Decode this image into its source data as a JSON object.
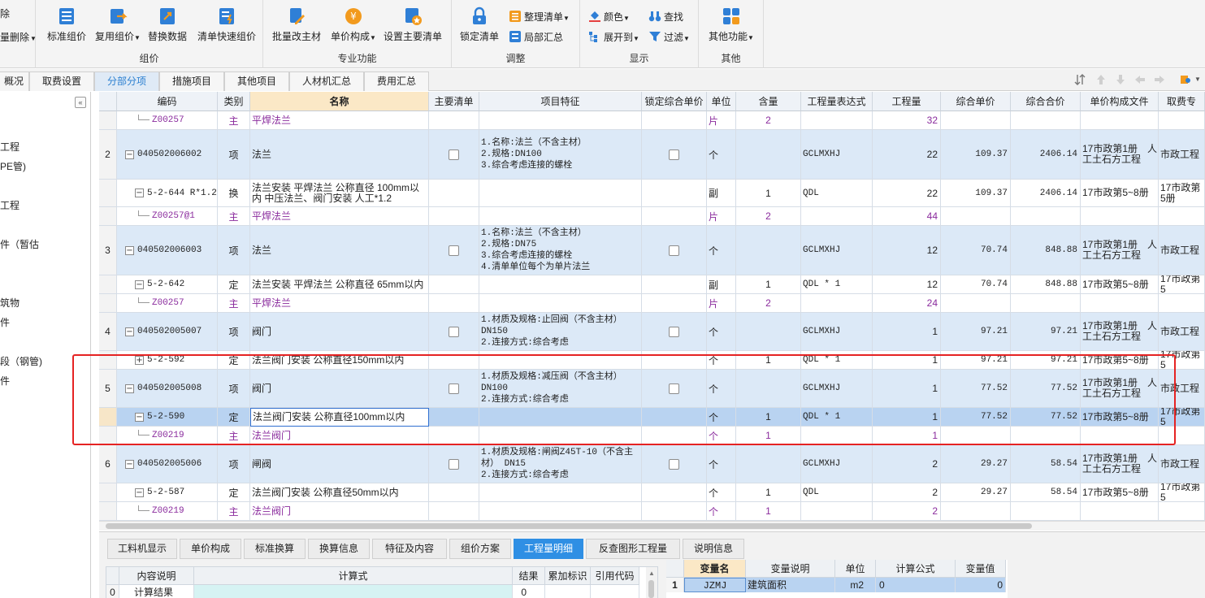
{
  "ribbon": {
    "cut_top": "除",
    "cut_bottom": "量删除",
    "group_zujia": {
      "label": "组价",
      "buttons": [
        "标准组价",
        "复用组价",
        "替换数据",
        "清单快速组价"
      ]
    },
    "group_zhuanye": {
      "label": "专业功能",
      "buttons": [
        "批量改主材",
        "单价构成",
        "设置主要清单"
      ]
    },
    "group_tiaozheng": {
      "label": "调整",
      "lock": "锁定清单",
      "sort": "整理清单",
      "local": "局部汇总"
    },
    "group_xianshi": {
      "label": "显示",
      "color": "颜色",
      "find": "查找",
      "expand": "展开到",
      "filter": "过滤"
    },
    "group_qita": {
      "label": "其他",
      "more": "其他功能"
    }
  },
  "tabs": [
    "概况",
    "取费设置",
    "分部分项",
    "措施项目",
    "其他项目",
    "人材机汇总",
    "费用汇总"
  ],
  "left_tree": [
    "工程",
    "PE管)",
    "工程",
    "件（暂估",
    "筑物",
    "件",
    "段（钢管)",
    "件"
  ],
  "grid": {
    "headers": [
      "编码",
      "类别",
      "名称",
      "主要清单",
      "项目特征",
      "锁定综合单价",
      "单位",
      "含量",
      "工程量表达式",
      "工程量",
      "综合单价",
      "综合合价",
      "单价构成文件",
      "取费专"
    ],
    "rows": [
      {
        "no": "",
        "code": "Z00257",
        "type": "主",
        "name": "平焊法兰",
        "feature": "",
        "unit": "片",
        "content": "2",
        "expr": "",
        "qty": "32",
        "price": "",
        "total": "",
        "file": "",
        "fee": ""
      },
      {
        "no": "2",
        "code": "040502006002",
        "type": "项",
        "name": "法兰",
        "feature": "1.名称:法兰（不含主材）\n2.规格:DN100\n3.综合考虑连接的螺栓",
        "unit": "个",
        "content": "",
        "expr": "GCLMXHJ",
        "qty": "22",
        "price": "109.37",
        "total": "2406.14",
        "file": "17市政第1册　人工土石方工程",
        "fee": "市政工程"
      },
      {
        "no": "",
        "code": "5-2-644 R*1.2",
        "type": "换",
        "name": "法兰安装 平焊法兰 公称直径 100mm以内 中压法兰、阀门安装 人工*1.2",
        "feature": "",
        "unit": "副",
        "content": "1",
        "expr": "QDL",
        "qty": "22",
        "price": "109.37",
        "total": "2406.14",
        "file": "17市政第5~8册",
        "fee": "17市政第5册"
      },
      {
        "no": "",
        "code": "Z00257@1",
        "type": "主",
        "name": "平焊法兰",
        "feature": "",
        "unit": "片",
        "content": "2",
        "expr": "",
        "qty": "44",
        "price": "",
        "total": "",
        "file": "",
        "fee": ""
      },
      {
        "no": "3",
        "code": "040502006003",
        "type": "项",
        "name": "法兰",
        "feature": "1.名称:法兰（不含主材）\n2.规格:DN75\n3.综合考虑连接的螺栓\n4.清单单位每个为单片法兰",
        "unit": "个",
        "content": "",
        "expr": "GCLMXHJ",
        "qty": "12",
        "price": "70.74",
        "total": "848.88",
        "file": "17市政第1册　人工土石方工程",
        "fee": "市政工程"
      },
      {
        "no": "",
        "code": "5-2-642",
        "type": "定",
        "name": "法兰安装 平焊法兰 公称直径 65mm以内",
        "feature": "",
        "unit": "副",
        "content": "1",
        "expr": "QDL * 1",
        "qty": "12",
        "price": "70.74",
        "total": "848.88",
        "file": "17市政第5~8册",
        "fee": "17市政第5"
      },
      {
        "no": "",
        "code": "Z00257",
        "type": "主",
        "name": "平焊法兰",
        "feature": "",
        "unit": "片",
        "content": "2",
        "expr": "",
        "qty": "24",
        "price": "",
        "total": "",
        "file": "",
        "fee": ""
      },
      {
        "no": "4",
        "code": "040502005007",
        "type": "项",
        "name": "阀门",
        "feature": "1.材质及规格:止回阀（不含主材）DN150\n2.连接方式:综合考虑",
        "unit": "个",
        "content": "",
        "expr": "GCLMXHJ",
        "qty": "1",
        "price": "97.21",
        "total": "97.21",
        "file": "17市政第1册　人工土石方工程",
        "fee": "市政工程"
      },
      {
        "no": "",
        "code": "5-2-592",
        "type": "定",
        "name": "法兰阀门安装 公称直径150mm以内",
        "feature": "",
        "unit": "个",
        "content": "1",
        "expr": "QDL * 1",
        "qty": "1",
        "price": "97.21",
        "total": "97.21",
        "file": "17市政第5~8册",
        "fee": "17市政第5"
      },
      {
        "no": "5",
        "code": "040502005008",
        "type": "项",
        "name": "阀门",
        "feature": "1.材质及规格:减压阀（不含主材）DN100\n2.连接方式:综合考虑",
        "unit": "个",
        "content": "",
        "expr": "GCLMXHJ",
        "qty": "1",
        "price": "77.52",
        "total": "77.52",
        "file": "17市政第1册　人工土石方工程",
        "fee": "市政工程"
      },
      {
        "no": "",
        "code": "5-2-590",
        "type": "定",
        "name": "法兰阀门安装 公称直径100mm以内",
        "feature": "",
        "unit": "个",
        "content": "1",
        "expr": "QDL * 1",
        "qty": "1",
        "price": "77.52",
        "total": "77.52",
        "file": "17市政第5~8册",
        "fee": "17市政第5"
      },
      {
        "no": "",
        "code": "Z00219",
        "type": "主",
        "name": "法兰阀门",
        "feature": "",
        "unit": "个",
        "content": "1",
        "expr": "",
        "qty": "1",
        "price": "",
        "total": "",
        "file": "",
        "fee": ""
      },
      {
        "no": "6",
        "code": "040502005006",
        "type": "项",
        "name": "闸阀",
        "feature": "1.材质及规格:闸阀Z45T-10（不含主材） DN15\n2.连接方式:综合考虑",
        "unit": "个",
        "content": "",
        "expr": "GCLMXHJ",
        "qty": "2",
        "price": "29.27",
        "total": "58.54",
        "file": "17市政第1册　人工土石方工程",
        "fee": "市政工程"
      },
      {
        "no": "",
        "code": "5-2-587",
        "type": "定",
        "name": "法兰阀门安装 公称直径50mm以内",
        "feature": "",
        "unit": "个",
        "content": "1",
        "expr": "QDL",
        "qty": "2",
        "price": "29.27",
        "total": "58.54",
        "file": "17市政第5~8册",
        "fee": "17市政第5"
      },
      {
        "no": "",
        "code": "Z00219",
        "type": "主",
        "name": "法兰阀门",
        "feature": "",
        "unit": "个",
        "content": "1",
        "expr": "",
        "qty": "2",
        "price": "",
        "total": "",
        "file": "",
        "fee": ""
      }
    ]
  },
  "bottom_tabs": [
    "工料机显示",
    "单价构成",
    "标准换算",
    "换算信息",
    "特征及内容",
    "组价方案",
    "工程量明细",
    "反查图形工程量",
    "说明信息"
  ],
  "detail_table": {
    "headers": [
      "内容说明",
      "计算式",
      "结果",
      "累加标识",
      "引用代码"
    ],
    "row": {
      "no": "0",
      "desc": "计算结果",
      "formula": "",
      "result": "0"
    }
  },
  "var_table": {
    "headers": [
      "变量名",
      "变量说明",
      "单位",
      "计算公式",
      "变量值"
    ],
    "row": {
      "no": "1",
      "name": "JZMJ",
      "desc": "建筑面积",
      "unit": "m2",
      "formula": "0",
      "value": "0"
    }
  },
  "colors": {
    "accent": "#2f8fe4",
    "highlight_row": "#dce9f7",
    "selected_row": "#b9d3f1",
    "red_box": "#e52323",
    "main_material": "#8a2b9d"
  }
}
